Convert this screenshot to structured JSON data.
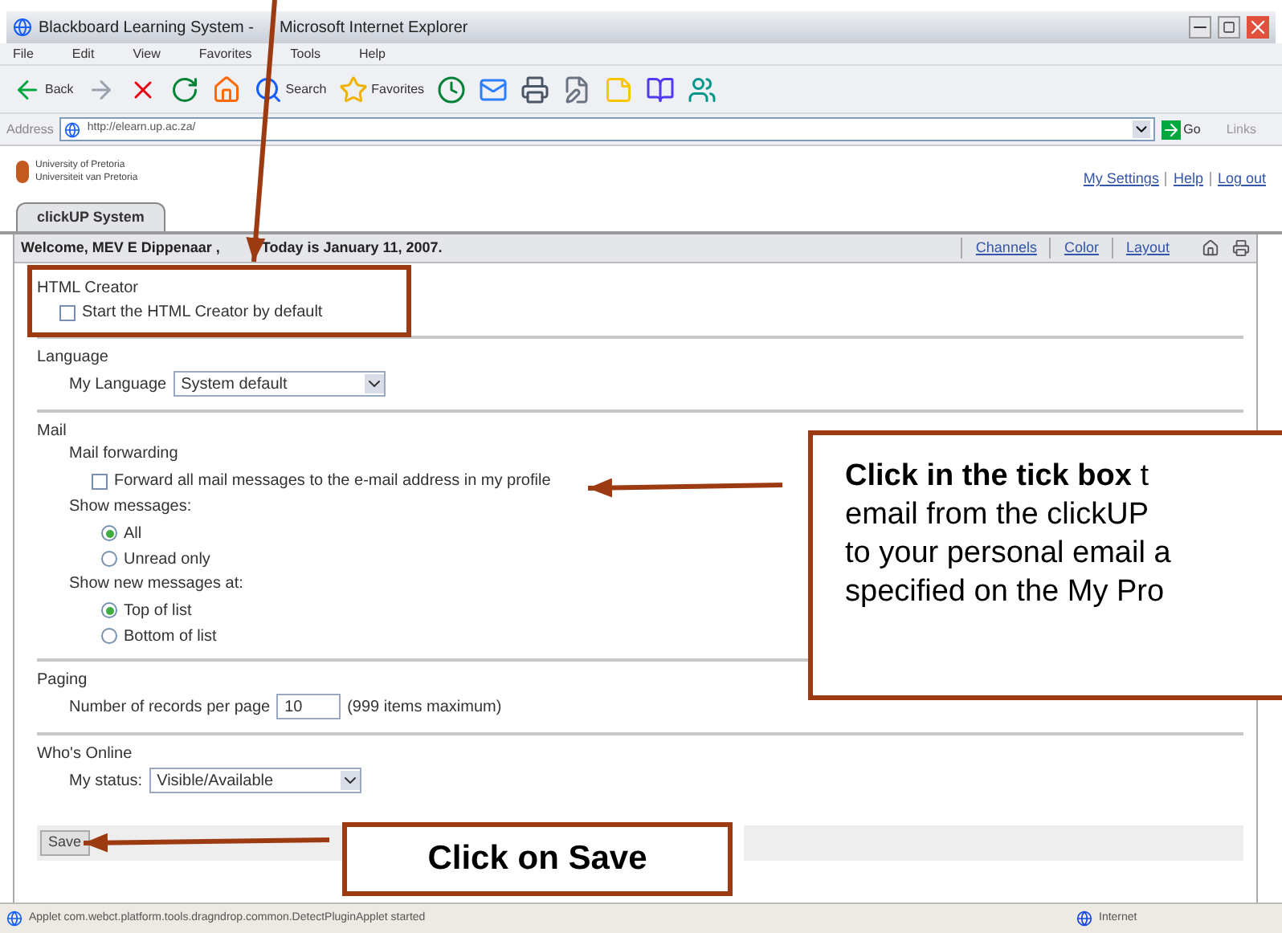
{
  "window": {
    "title": [
      "Blackboard Learning System -",
      "Microsoft Internet Explorer"
    ]
  },
  "menu": [
    "File",
    "Edit",
    "View",
    "Favorites",
    "Tools",
    "Help"
  ],
  "toolbar": [
    {
      "kind": "back",
      "label": "Back"
    },
    {
      "kind": "forward"
    },
    {
      "kind": "stop"
    },
    {
      "kind": "refresh"
    },
    {
      "kind": "home"
    },
    {
      "kind": "search",
      "label": "Search"
    },
    {
      "kind": "favorites",
      "label": "Favorites"
    },
    {
      "kind": "history"
    },
    {
      "kind": "mail"
    },
    {
      "kind": "print"
    },
    {
      "kind": "edit"
    },
    {
      "kind": "note"
    },
    {
      "kind": "research"
    },
    {
      "kind": "messenger"
    }
  ],
  "address": {
    "label": "Address",
    "url": "http://elearn.up.ac.za/",
    "go": "Go",
    "links": "Links"
  },
  "header": {
    "logo_lines": [
      "University of Pretoria",
      "Universiteit van Pretoria"
    ],
    "links": [
      "My Settings",
      "Help",
      "Log out"
    ]
  },
  "tabs": [
    {
      "label": "clickUP System",
      "selected": true
    }
  ],
  "welcome": [
    "Welcome, MEV E Dippenaar ,",
    "Today is January 11, 2007."
  ],
  "view_links": [
    "Channels",
    "Color",
    "Layout"
  ],
  "sections": [
    {
      "title": "HTML Creator",
      "rows": [
        {
          "kind": "checkbox",
          "label": "Start the HTML Creator by default",
          "checked": false
        }
      ]
    },
    {
      "title": "Language",
      "rows": [
        {
          "kind": "select",
          "label": "My Language",
          "value": "System default"
        }
      ]
    },
    {
      "title": "Mail",
      "rows": [
        {
          "kind": "group",
          "label": "Mail forwarding",
          "children": [
            {
              "kind": "checkbox",
              "label": "Forward all mail messages to the e-mail address in my profile",
              "checked": false
            }
          ]
        },
        {
          "kind": "group",
          "label": "Show messages:",
          "children": [
            {
              "kind": "radio",
              "label": "All",
              "selected": true
            },
            {
              "kind": "radio",
              "label": "Unread only",
              "selected": false
            }
          ]
        },
        {
          "kind": "group",
          "label": "Show new messages at:",
          "children": [
            {
              "kind": "radio",
              "label": "Top of list",
              "selected": true
            },
            {
              "kind": "radio",
              "label": "Bottom of list",
              "selected": false
            }
          ]
        }
      ]
    },
    {
      "title": "Paging",
      "rows": [
        {
          "kind": "number",
          "label": "Number of records per page",
          "value": "10",
          "note": "(999 items maximum)"
        }
      ]
    },
    {
      "title": "Who's Online",
      "rows": [
        {
          "kind": "select",
          "label": "My status:",
          "value": "Visible/Available"
        }
      ]
    }
  ],
  "buttons": [
    "Save"
  ],
  "status_bar": {
    "text": "Applet com.webct.platform.tools.dragndrop.common.DetectPluginApplet started",
    "zone": "Internet"
  },
  "callouts": [
    {
      "kind": "note",
      "lines": [
        "**Click in the tick box** t",
        "email from the clickUP",
        "to your personal email a",
        "specified on the My Pro"
      ]
    },
    {
      "kind": "label",
      "lines": [
        "Click on Save"
      ]
    }
  ]
}
